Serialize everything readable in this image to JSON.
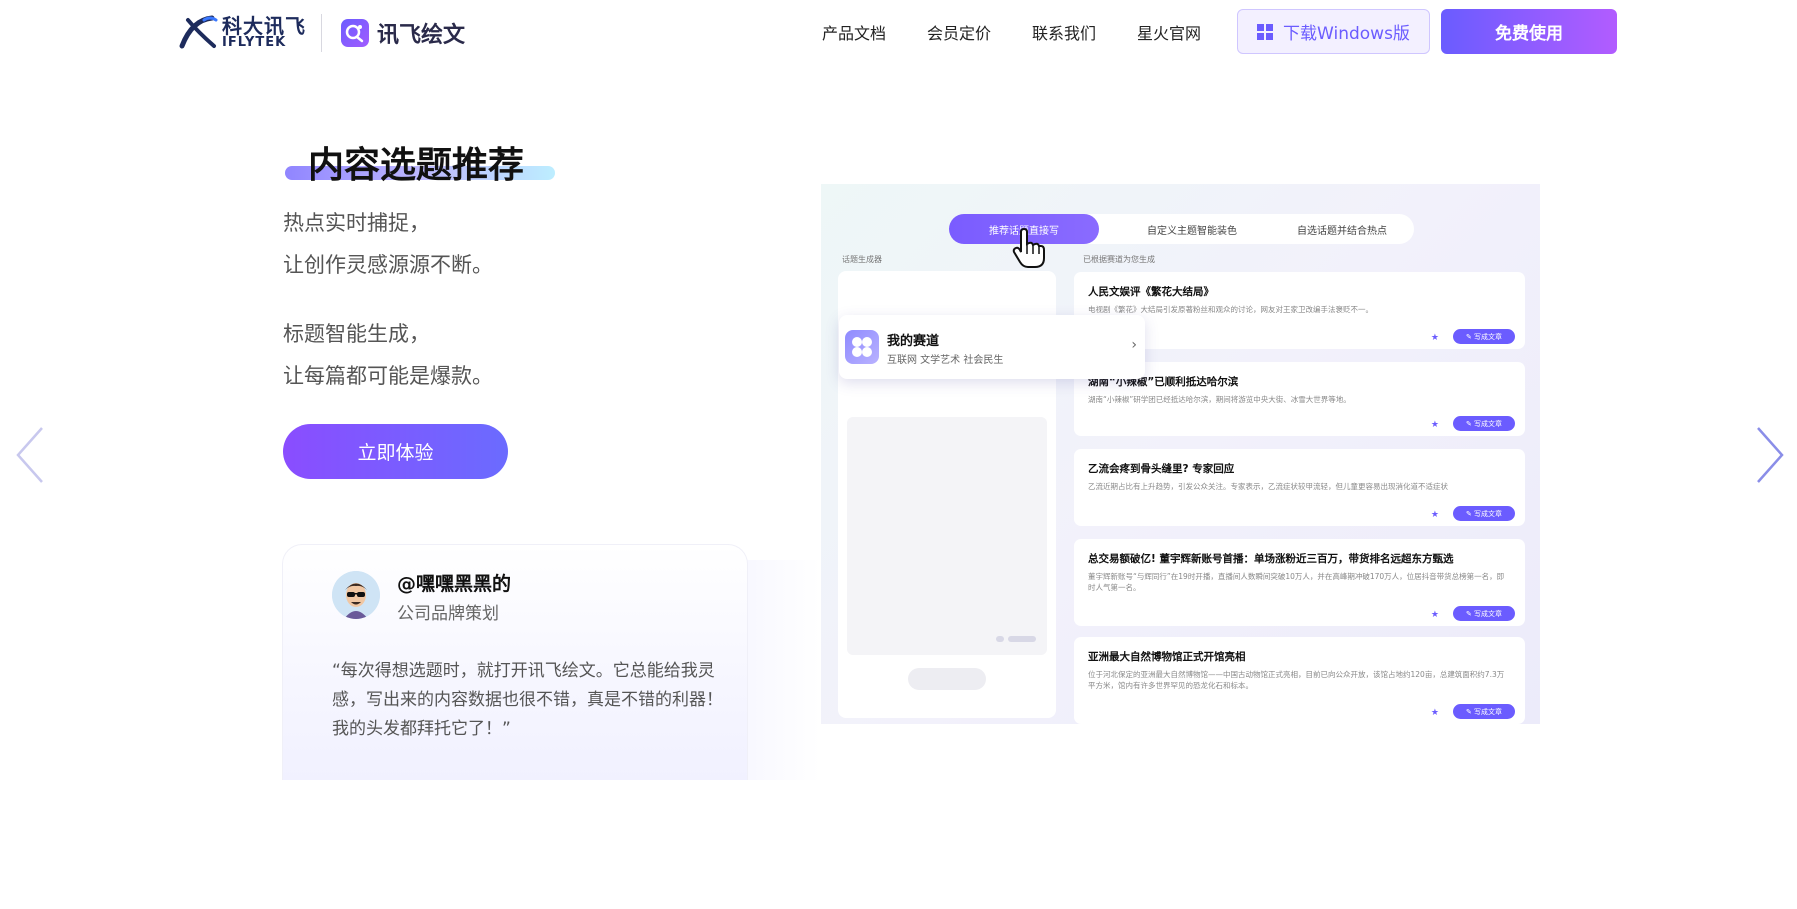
{
  "header": {
    "brand_cn": "科大讯飞",
    "brand_en": "IFLYTEK",
    "app_name": "讯飞绘文",
    "nav": [
      "产品文档",
      "会员定价",
      "联系我们",
      "星火官网"
    ],
    "download_label": "下载Windows版",
    "free_label": "免费使用"
  },
  "hero": {
    "title": "内容选题推荐",
    "desc_lines": [
      "热点实时捕捉，",
      "让创作灵感源源不断。",
      "标题智能生成，",
      "让每篇都可能是爆款。"
    ],
    "cta_label": "立即体验"
  },
  "testimonial": {
    "name": "@嘿嘿黑黑的",
    "role": "公司品牌策划",
    "quote": "“每次得想选题时，就打开讯飞绘文。它总能给我灵感，写出来的内容数据也很不错，真是不错的利器！我的头发都拜托它了！”"
  },
  "mockup": {
    "tabs": [
      "推荐话题直接写",
      "自定义主题智能装色",
      "自选话题并结合热点"
    ],
    "left_label": "话题生成器",
    "right_label": "已根据赛道为您生成",
    "popup": {
      "title": "我的赛道",
      "subtitle": "互联网 文学艺术 社会民生",
      "chevron": "›"
    },
    "cards": [
      {
        "title": "人民文娱评《繁花大结局》",
        "desc": "电视剧《繁花》大结局引发原著粉丝和观众的讨论，网友对王家卫改编手法褒贬不一。",
        "button": "✎ 写成文章"
      },
      {
        "title": "湖南“小辣椒”已顺利抵达哈尔滨",
        "desc": "湖南“小辣椒”研学团已经抵达哈尔滨，期间将游览中央大街、冰雪大世界等地。",
        "button": "✎ 写成文章"
      },
      {
        "title": "乙流会疼到骨头缝里? 专家回应",
        "desc": "乙流近期占比有上升趋势，引发公众关注。专家表示，乙流症状较甲流轻，但儿童更容易出现消化道不适症状",
        "button": "✎ 写成文章"
      },
      {
        "title": "总交易额破亿! 董宇辉新账号首播：单场涨粉近三百万，带货排名远超东方甄选",
        "desc": "董宇辉新账号“与辉同行”在19时开播，直播间人数瞬间突破10万人，并在高峰期冲破170万人，位居抖音带货总榜第一名，即时人气第一名。",
        "button": "✎ 写成文章"
      },
      {
        "title": "亚洲最大自然博物馆正式开馆亮相",
        "desc": "位于河北保定的亚洲最大自然博物馆——中国古动物馆正式亮相，目前已向公众开放，该馆占地约120亩，总建筑面积约7.3万平方米，馆内有许多世界罕见的恐龙化石和标本。",
        "button": "✎ 写成文章"
      }
    ]
  },
  "colors": {
    "accent": "#6b5cff",
    "accent2": "#b25cff",
    "arrow": "#8a8ee8"
  }
}
